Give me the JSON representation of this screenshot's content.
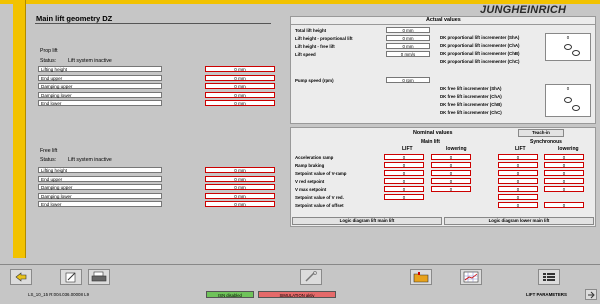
{
  "brand": {
    "logo": "JUNGHEINRICH"
  },
  "page": {
    "title": "Main lift geometry DZ"
  },
  "prop_lift": {
    "heading": "Prop lift",
    "status_label": "Status:",
    "status_value": "Lift system inactive",
    "rows": [
      {
        "label": "Lifting height",
        "value": "0 mm"
      },
      {
        "label": "End upper",
        "value": "0 mm"
      },
      {
        "label": "Damping upper",
        "value": "0 mm"
      },
      {
        "label": "Damping lower",
        "value": "0 mm"
      },
      {
        "label": "End lower",
        "value": "0 mm"
      }
    ]
  },
  "free_lift": {
    "heading": "Free lift",
    "status_label": "Status:",
    "status_value": "Lift system inactive",
    "rows": [
      {
        "label": "Lifting height",
        "value": "0 mm"
      },
      {
        "label": "End upper",
        "value": "0 mm"
      },
      {
        "label": "Damping upper",
        "value": "0 mm"
      },
      {
        "label": "Damping lower",
        "value": "0 mm"
      },
      {
        "label": "End lower",
        "value": "0 mm"
      }
    ]
  },
  "actual": {
    "title": "Actual values",
    "left": [
      {
        "label": "Total lift height",
        "value": "0 mm"
      },
      {
        "label": "Lift height - proportional lift",
        "value": "0 mm"
      },
      {
        "label": "Lift height - free lift",
        "value": "0 mm"
      },
      {
        "label": "Lift speed",
        "value": "0 mm/s"
      }
    ],
    "pump_label": "Pump speed (rpm)",
    "pump_value": "0 rpm",
    "prop_incr": [
      "DK proportional lift incrementer (ShA)",
      "DK proportional lift incrementer (ChA)",
      "DK proportional lift incrementer (ChB)",
      "DK proportional lift incrementer (ChC)"
    ],
    "prop_incr_value": "0",
    "free_incr": [
      "DK free lift incrementer (ShA)",
      "DK free lift incrementer (ChA)",
      "DK free lift incrementer (ChB)",
      "DK free lift incrementer (ChC)"
    ],
    "free_incr_value": "0"
  },
  "nominal": {
    "title": "Nominal values",
    "teach_in": "Teach-in",
    "main_lift": "Main lift",
    "synchronous": "Synchronous",
    "lift": "LIFT",
    "lowering": "lowering",
    "rows": [
      {
        "label": "Acceleration ramp",
        "v": [
          "0",
          "0",
          "0",
          "0"
        ]
      },
      {
        "label": "Ramp braking",
        "v": [
          "0",
          "0",
          "0",
          "0"
        ]
      },
      {
        "label": "Setpoint value of V-ramp",
        "v": [
          "0",
          "0",
          "0",
          "0"
        ]
      },
      {
        "label": "V red setpoint",
        "v": [
          "0",
          "0",
          "0",
          "0"
        ]
      },
      {
        "label": "V max setpoint",
        "v": [
          "0",
          "0",
          "0",
          "0"
        ]
      },
      {
        "label": "Setpoint value of V red.",
        "v": [
          "0",
          "",
          "0",
          ""
        ]
      },
      {
        "label": "Setpoint value of offset",
        "v": [
          "",
          "",
          "0",
          "0"
        ]
      }
    ],
    "btn_left": "Logic diagram lift main lift",
    "btn_right": "Logic diagram lower main lift"
  },
  "status_bar": {
    "left_text": "LS_10_15 R:004.036.00008 L9",
    "pill_green": "ISN disabled",
    "pill_red": "SIMULATION aktiv",
    "right_text": "LIFT PARAMETERS"
  },
  "colors": {
    "accent_yellow": "#f2c200",
    "pill_green": "#6fc35a",
    "pill_red": "#e56a6a"
  }
}
